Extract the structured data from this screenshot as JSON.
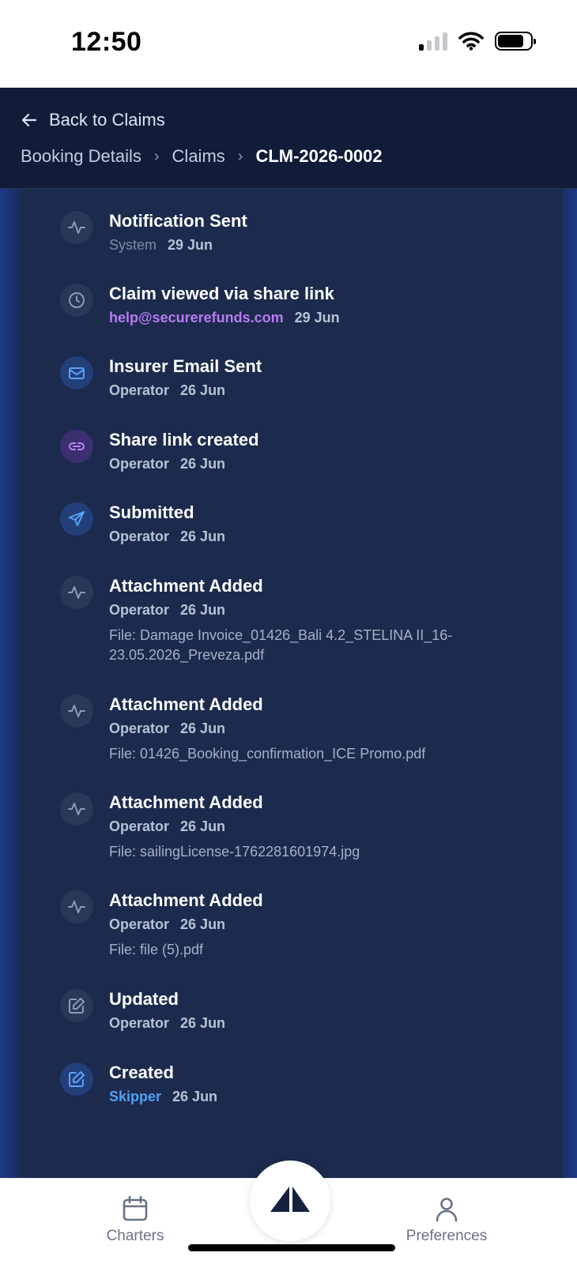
{
  "status_bar": {
    "time": "12:50"
  },
  "header": {
    "back_label": "Back to Claims",
    "breadcrumb": [
      "Booking Details",
      "Claims",
      "CLM-2026-0002"
    ]
  },
  "timeline": [
    {
      "title": "Notification Sent",
      "actor": "System",
      "date": "29 Jun",
      "icon": "activity-icon"
    },
    {
      "title": "Claim viewed via share link",
      "actor": "help@securerefunds.com",
      "date": "29 Jun",
      "icon": "clock-icon"
    },
    {
      "title": "Insurer Email Sent",
      "actor": "Operator",
      "date": "26 Jun",
      "icon": "mail-icon"
    },
    {
      "title": "Share link created",
      "actor": "Operator",
      "date": "26 Jun",
      "icon": "link-icon"
    },
    {
      "title": "Submitted",
      "actor": "Operator",
      "date": "26 Jun",
      "icon": "send-icon"
    },
    {
      "title": "Attachment Added",
      "actor": "Operator",
      "date": "26 Jun",
      "file": "File: Damage Invoice_01426_Bali 4.2_STELINA II_16-23.05.2026_Preveza.pdf",
      "icon": "activity-icon"
    },
    {
      "title": "Attachment Added",
      "actor": "Operator",
      "date": "26 Jun",
      "file": "File: 01426_Booking_confirmation_ICE Promo.pdf",
      "icon": "activity-icon"
    },
    {
      "title": "Attachment Added",
      "actor": "Operator",
      "date": "26 Jun",
      "file": "File: sailingLicense-1762281601974.jpg",
      "icon": "activity-icon"
    },
    {
      "title": "Attachment Added",
      "actor": "Operator",
      "date": "26 Jun",
      "file": "File: file (5).pdf",
      "icon": "activity-icon"
    },
    {
      "title": "Updated",
      "actor": "Operator",
      "date": "26 Jun",
      "icon": "edit-icon"
    },
    {
      "title": "Created",
      "actor": "Skipper",
      "date": "26 Jun",
      "icon": "edit-icon"
    }
  ],
  "bottom_nav": {
    "charters_label": "Charters",
    "preferences_label": "Preferences"
  },
  "colors": {
    "header_bg": "#121c38",
    "panel_bg": "#1c2a4d",
    "accent_purple": "#b77cf2",
    "accent_blue": "#4fa0f4"
  }
}
